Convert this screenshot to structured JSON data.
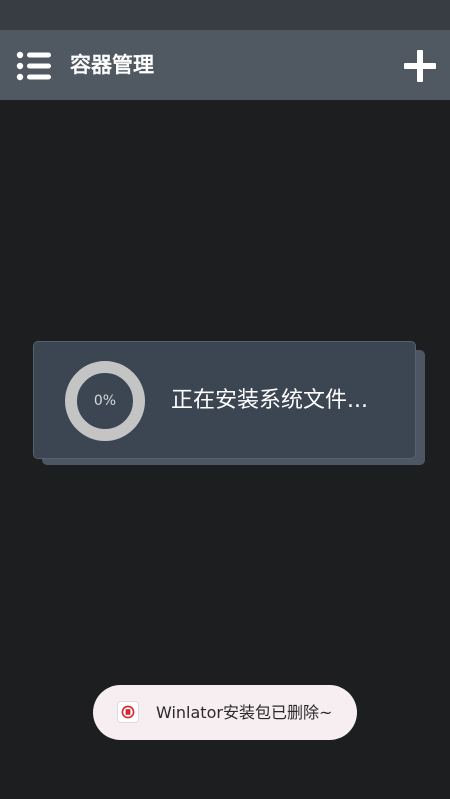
{
  "app_bar": {
    "title": "容器管理",
    "menu_icon": "menu-list-icon",
    "add_icon": "plus-icon"
  },
  "dialog": {
    "progress_percent": 0,
    "progress_label": "0%",
    "message": "正在安装系统文件..."
  },
  "toast": {
    "icon": "app-logo-icon",
    "message": "Winlator安装包已删除~"
  },
  "colors": {
    "background": "#1c1e20",
    "status_bar": "#383d44",
    "app_bar": "#505962",
    "dialog": "#3b4652",
    "progress_track": "#c4c4c4",
    "toast_background": "#f6eef0",
    "logo_red": "#d0282c"
  }
}
